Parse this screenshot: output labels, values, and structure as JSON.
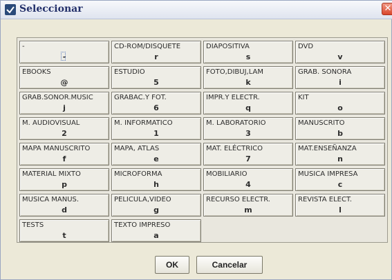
{
  "window": {
    "title": "Seleccionar",
    "close_symbol": "✕"
  },
  "options": [
    {
      "label": "-",
      "code": "-"
    },
    {
      "label": "CD-ROM/DISQUETE",
      "code": "r"
    },
    {
      "label": "DIAPOSITIVA",
      "code": "s"
    },
    {
      "label": "DVD",
      "code": "v"
    },
    {
      "label": "EBOOKS",
      "code": "@"
    },
    {
      "label": "ESTUDIO",
      "code": "5"
    },
    {
      "label": "FOTO,DIBUJ,LAM",
      "code": "k"
    },
    {
      "label": "GRAB. SONORA",
      "code": "i"
    },
    {
      "label": "GRAB.SONOR.MUSIC",
      "code": "j"
    },
    {
      "label": "GRABAC.Y FOT.",
      "code": "6"
    },
    {
      "label": "IMPR.Y ELECTR.",
      "code": "q"
    },
    {
      "label": "KIT",
      "code": "o"
    },
    {
      "label": "M. AUDIOVISUAL",
      "code": "2"
    },
    {
      "label": "M. INFORMATICO",
      "code": "1"
    },
    {
      "label": "M. LABORATORIO",
      "code": "3"
    },
    {
      "label": "MANUSCRITO",
      "code": "b"
    },
    {
      "label": "MAPA MANUSCRITO",
      "code": "f"
    },
    {
      "label": "MAPA, ATLAS",
      "code": "e"
    },
    {
      "label": "MAT. ELÉCTRICO",
      "code": "7"
    },
    {
      "label": "MAT.ENSEÑANZA",
      "code": "n"
    },
    {
      "label": "MATERIAL MIXTO",
      "code": "p"
    },
    {
      "label": "MICROFORMA",
      "code": "h"
    },
    {
      "label": "MOBILIARIO",
      "code": "4"
    },
    {
      "label": "MUSICA IMPRESA",
      "code": "c"
    },
    {
      "label": "MUSICA MANUS.",
      "code": "d"
    },
    {
      "label": "PELICULA,VIDEO",
      "code": "g"
    },
    {
      "label": "RECURSO ELECTR.",
      "code": "m"
    },
    {
      "label": "REVISTA ELECT.",
      "code": "l"
    },
    {
      "label": "TESTS",
      "code": "t"
    },
    {
      "label": "TEXTO IMPRESO",
      "code": "a"
    }
  ],
  "buttons": {
    "ok_label": "OK",
    "cancel_label": "Cancelar"
  },
  "colors": {
    "title_text": "#23306a",
    "close_button": "#d9462c"
  }
}
